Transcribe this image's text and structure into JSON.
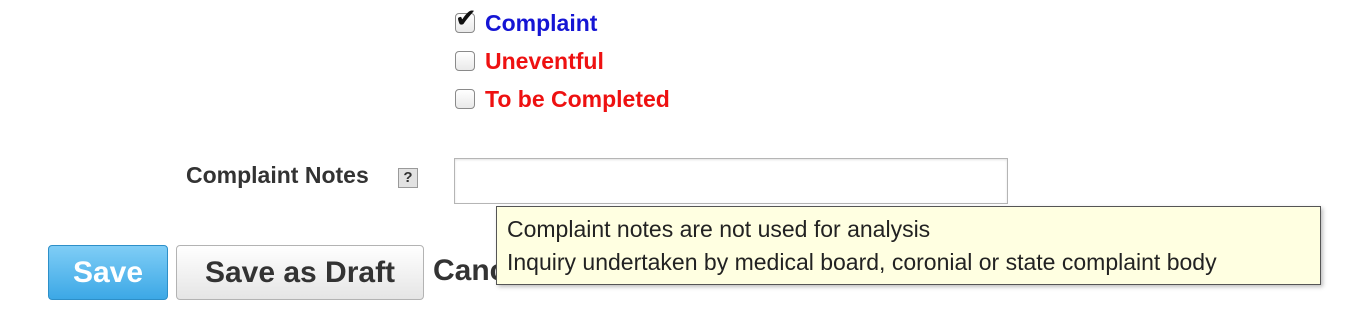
{
  "colors": {
    "checked_label": "#1515d4",
    "unchecked_label": "#ee1111",
    "save_button": "#3ca8e6",
    "tooltip_bg": "#ffffe1"
  },
  "options": [
    {
      "label": "Complaint",
      "checked": true
    },
    {
      "label": "Uneventful",
      "checked": false
    },
    {
      "label": "To be Completed",
      "checked": false
    }
  ],
  "notes": {
    "label": "Complaint Notes",
    "help_icon": "question-mark-icon",
    "help_glyph": "?",
    "value": "",
    "placeholder": ""
  },
  "tooltip": {
    "lines": [
      "Complaint notes are not used for analysis",
      "Inquiry undertaken by medical board, coronial or state complaint body"
    ]
  },
  "actions": {
    "save_label": "Save",
    "draft_label": "Save as Draft",
    "cancel_label": "Cancel"
  }
}
